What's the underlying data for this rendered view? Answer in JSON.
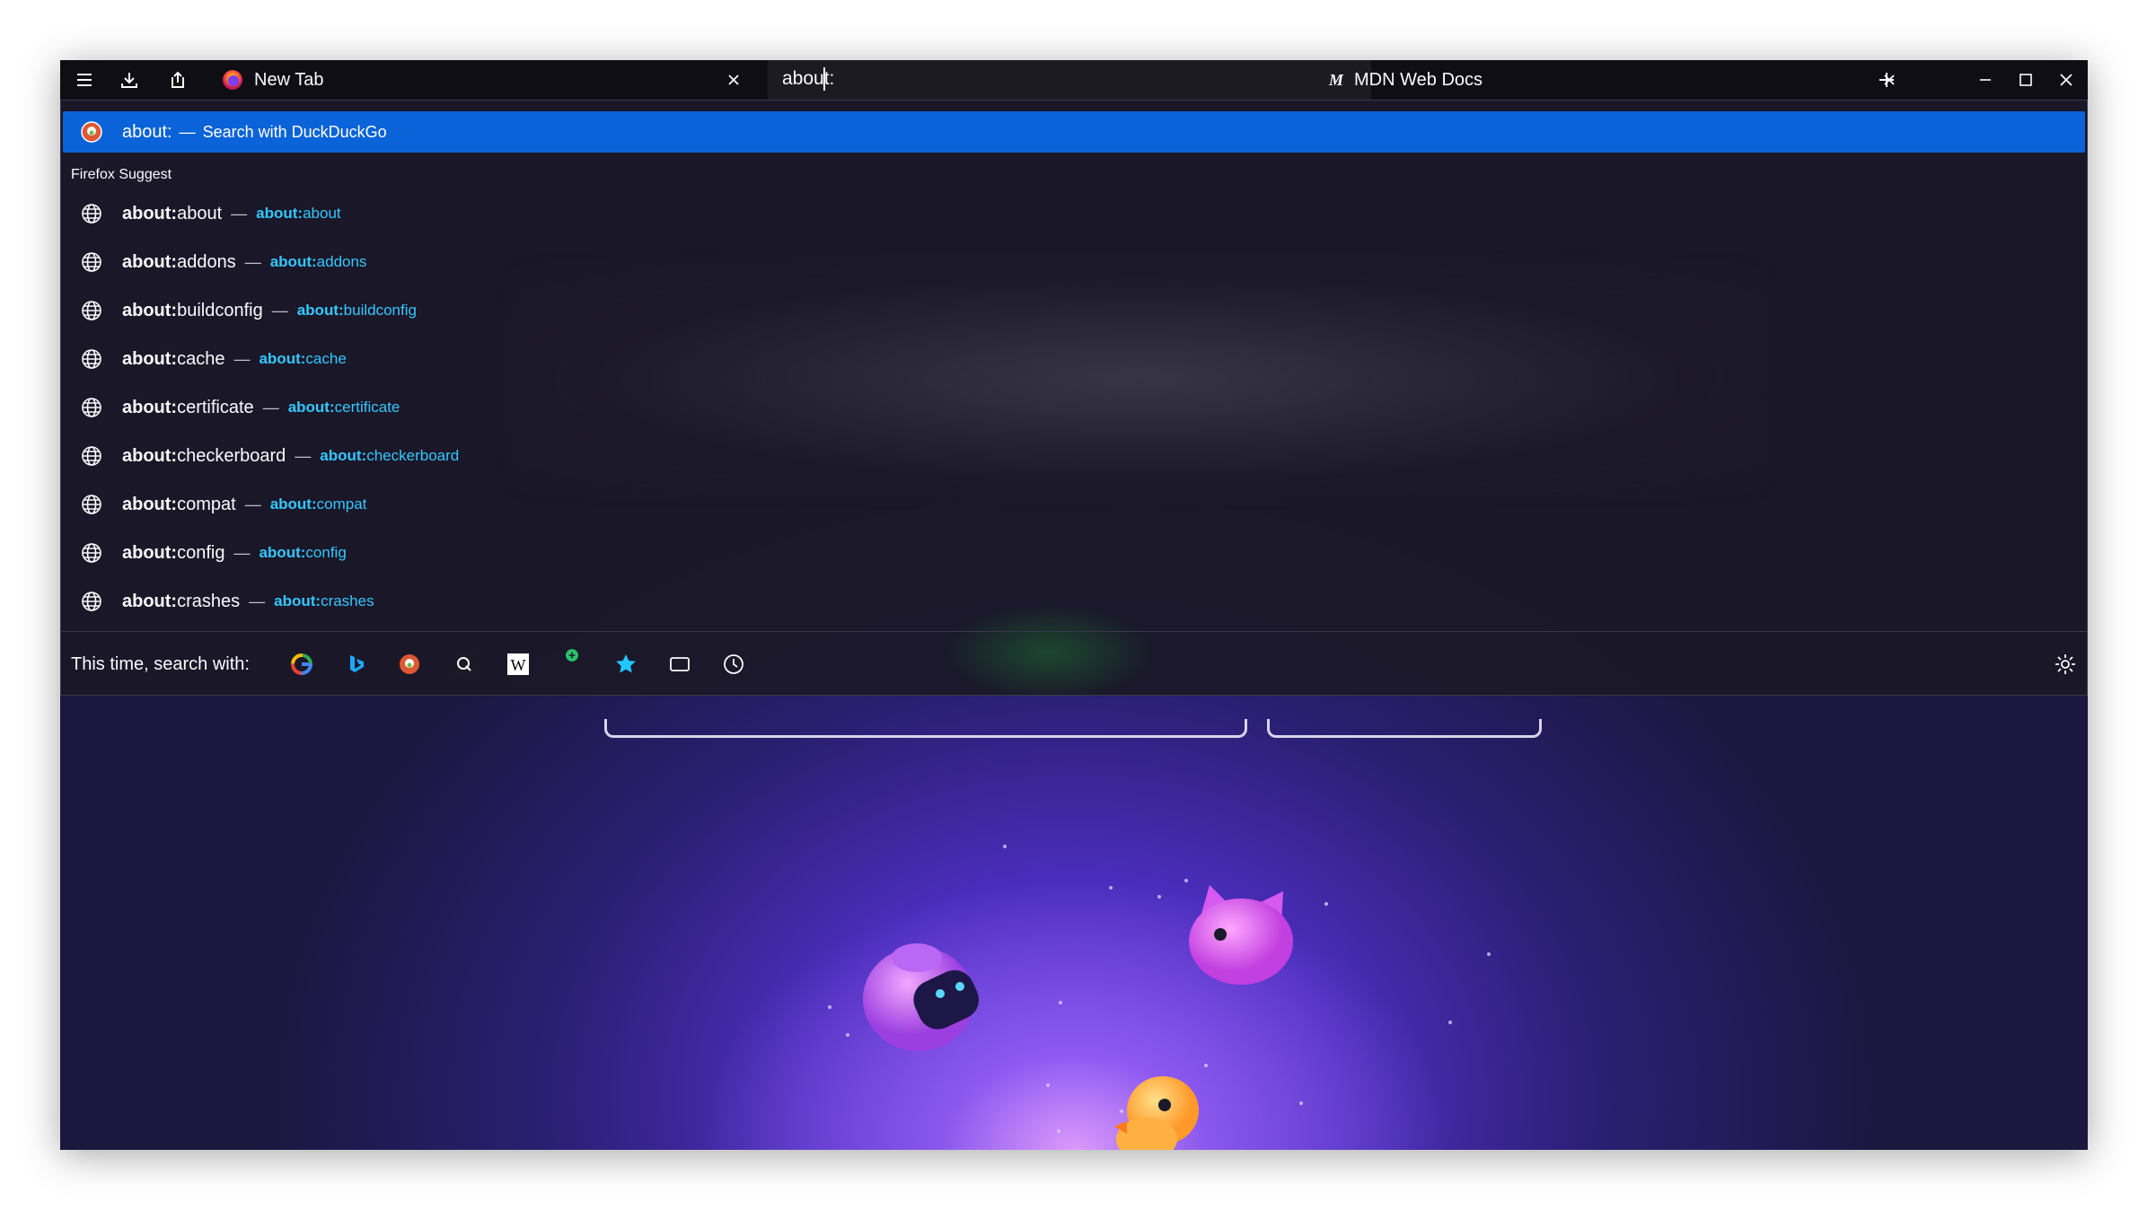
{
  "window": {
    "accent_color": "#0b63d9",
    "link_color": "#33c8ff",
    "titlebar_color": "#0f0e14"
  },
  "toolbar": {
    "menu_icon": "hamburger-menu-icon",
    "downloads_icon": "download-icon",
    "share_icon": "share-icon"
  },
  "tabs": [
    {
      "label": "New Tab",
      "icon": "firefox-logo-icon"
    },
    {
      "label": "MDN Web Docs",
      "icon": "mdn-logo-icon"
    }
  ],
  "urlbar": {
    "value": "about:"
  },
  "window_controls": {
    "new_tab": "plus-icon",
    "minimize": "minimize-icon",
    "maximize": "maximize-icon",
    "close": "close-icon"
  },
  "heuristic": {
    "title": "about:",
    "separator": "—",
    "action": "Search with DuckDuckGo",
    "icon": "duckduckgo-icon"
  },
  "group_label": "Firefox Suggest",
  "suggestions": [
    {
      "title_bold": "about:",
      "title_rest": "about",
      "sep": "—",
      "url_bold": "about:",
      "url_rest": "about"
    },
    {
      "title_bold": "about:",
      "title_rest": "addons",
      "sep": "—",
      "url_bold": "about:",
      "url_rest": "addons"
    },
    {
      "title_bold": "about:",
      "title_rest": "buildconfig",
      "sep": "—",
      "url_bold": "about:",
      "url_rest": "buildconfig"
    },
    {
      "title_bold": "about:",
      "title_rest": "cache",
      "sep": "—",
      "url_bold": "about:",
      "url_rest": "cache"
    },
    {
      "title_bold": "about:",
      "title_rest": "certificate",
      "sep": "—",
      "url_bold": "about:",
      "url_rest": "certificate"
    },
    {
      "title_bold": "about:",
      "title_rest": "checkerboard",
      "sep": "—",
      "url_bold": "about:",
      "url_rest": "checkerboard"
    },
    {
      "title_bold": "about:",
      "title_rest": "compat",
      "sep": "—",
      "url_bold": "about:",
      "url_rest": "compat"
    },
    {
      "title_bold": "about:",
      "title_rest": "config",
      "sep": "—",
      "url_bold": "about:",
      "url_rest": "config"
    },
    {
      "title_bold": "about:",
      "title_rest": "crashes",
      "sep": "—",
      "url_bold": "about:",
      "url_rest": "crashes"
    }
  ],
  "one_off": {
    "label": "This time, search with:",
    "engines": [
      "google-icon",
      "bing-icon",
      "duckduckgo-icon",
      "qwant-icon",
      "wikipedia-icon",
      "add-engine-icon",
      "bookmarks-star-icon",
      "tabs-icon",
      "history-clock-icon"
    ],
    "wikipedia_glyph": "W",
    "settings_icon": "gear-icon"
  }
}
